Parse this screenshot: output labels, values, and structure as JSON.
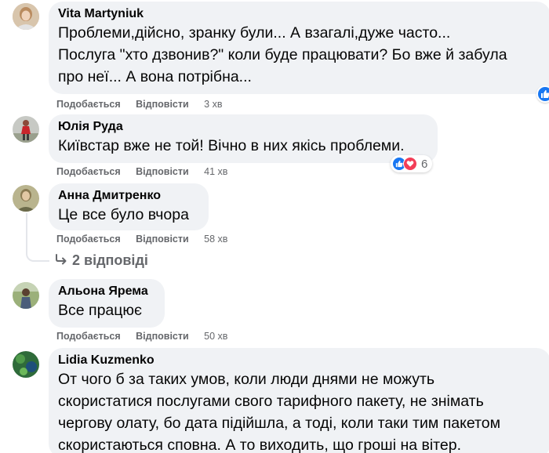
{
  "comments": [
    {
      "author": "Vita Martyniuk",
      "text": "Проблеми,дійсно, зранку були... А взагалі,дуже часто...\nПослуга \"хто дзвонив?\" коли буде працювати? Бо вже й забула\nпро неї... А вона потрібна...",
      "like_label": "Подобається",
      "reply_label": "Відповісти",
      "time": "3 хв"
    },
    {
      "author": "Юлія Руда",
      "text": "Київстар вже не той! Вічно в них якісь проблеми.",
      "like_label": "Подобається",
      "reply_label": "Відповісти",
      "time": "41 хв",
      "reaction_count": "6",
      "reaction_icons": [
        "like-icon",
        "love-icon"
      ]
    },
    {
      "author": "Анна Дмитренко",
      "text": "Це все було вчора",
      "like_label": "Подобається",
      "reply_label": "Відповісти",
      "time": "58 хв",
      "replies_label": "2 відповіді"
    },
    {
      "author": "Альона Ярема",
      "text": "Все працює",
      "like_label": "Подобається",
      "reply_label": "Відповісти",
      "time": "50 хв"
    },
    {
      "author": "Lidia Kuzmenko",
      "text": "От чого б за таких умов, коли люди днями не можуть\nскористатися послугами свого тарифного пакету, не знімать\nчергову олату, бо дата підійшла, а тоді, коли таки тим пакетом\nскористаються сповна. А то виходить, що гроші на вітер."
    }
  ],
  "colors": {
    "bubble": "#f0f2f5",
    "secondary_text": "#65676b",
    "like_blue": "#1877f2",
    "love_red": "#f33e58"
  }
}
